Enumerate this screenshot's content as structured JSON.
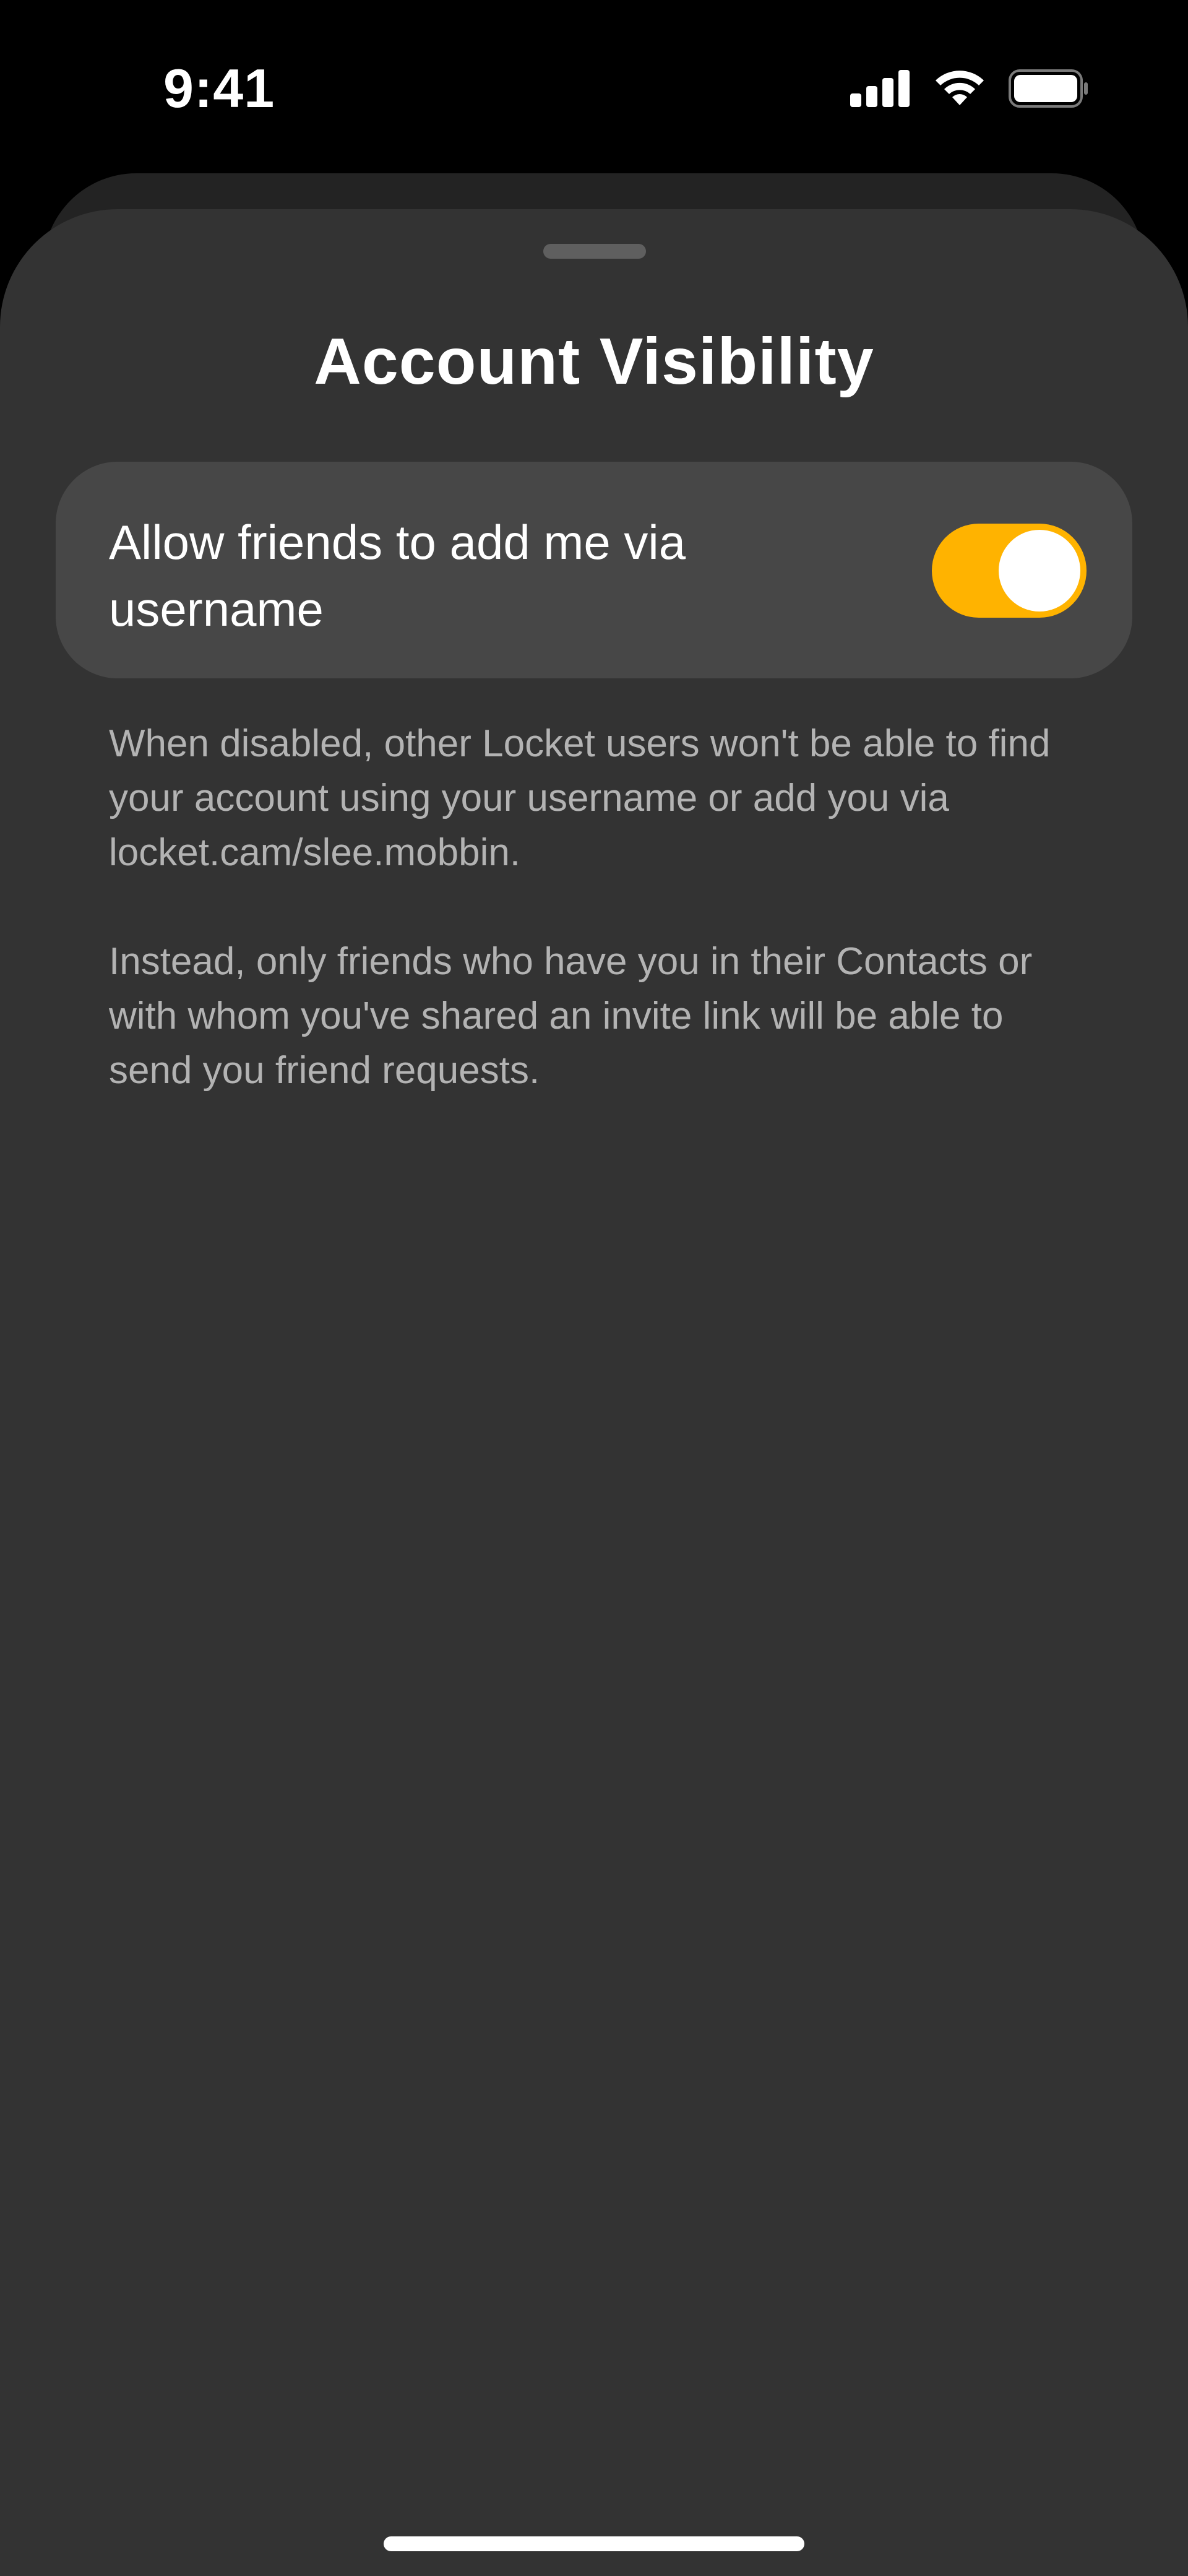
{
  "status_bar": {
    "time": "9:41",
    "icons": [
      "cellular-signal-icon",
      "wifi-icon",
      "battery-icon"
    ]
  },
  "sheet": {
    "title": "Account Visibility"
  },
  "setting": {
    "label": "Allow friends to add me via username",
    "enabled": true,
    "accent_color": "#FFB300"
  },
  "description": {
    "paragraph_1": "When disabled, other Locket users won't be able to find your account using your username or add you via locket.cam/slee.mobbin.",
    "paragraph_2": "Instead, only friends who have you in their Contacts or with whom you've shared an invite link will be able to send you friend requests."
  },
  "colors": {
    "background": "#000000",
    "sheet": "#333333",
    "row": "#474747",
    "secondary_text": "#B3B3B3"
  }
}
